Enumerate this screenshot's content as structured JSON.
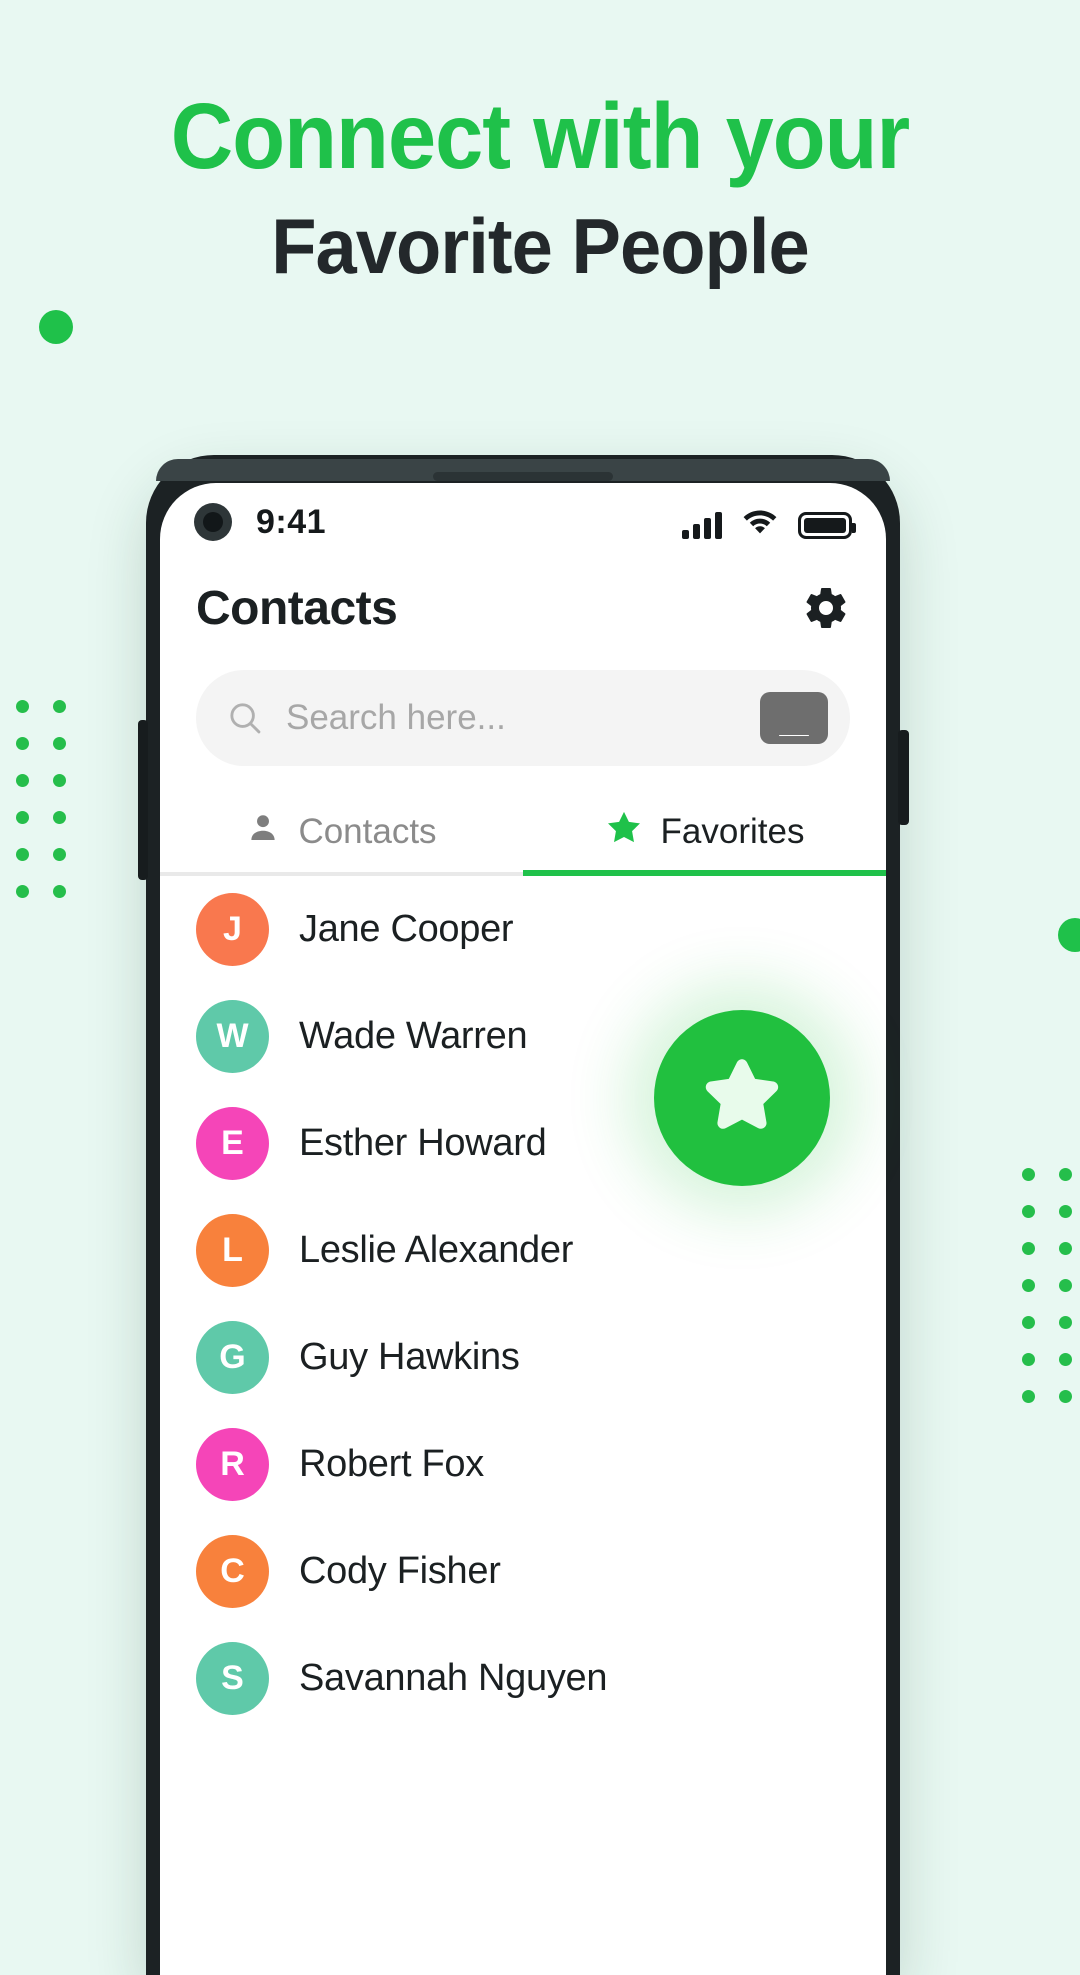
{
  "promo": {
    "headline_line1": "Connect with your",
    "headline_line2": "Favorite People",
    "accent_color": "#1FC14A",
    "dark_color": "#23282B",
    "background_color": "#E8F8F2"
  },
  "phone": {
    "statusbar": {
      "time": "9:41",
      "signal_icon": "signal-bars-icon",
      "wifi_icon": "wifi-icon",
      "battery_icon": "battery-full-icon",
      "camera_icon": "front-camera-icon"
    },
    "header": {
      "title": "Contacts",
      "settings_icon": "gear-icon"
    },
    "search": {
      "placeholder": "Search here...",
      "value": "",
      "search_icon": "search-icon",
      "keyboard_icon": "keyboard-icon"
    },
    "tabs": [
      {
        "label": "Contacts",
        "icon": "person-icon",
        "active": false
      },
      {
        "label": "Favorites",
        "icon": "star-icon",
        "active": true
      }
    ],
    "contacts": [
      {
        "initial": "J",
        "name": "Jane Cooper",
        "color": "#F9784E"
      },
      {
        "initial": "W",
        "name": "Wade Warren",
        "color": "#5FC9A9"
      },
      {
        "initial": "E",
        "name": "Esther Howard",
        "color": "#F545B8"
      },
      {
        "initial": "L",
        "name": "Leslie Alexander",
        "color": "#F8813C"
      },
      {
        "initial": "G",
        "name": "Guy Hawkins",
        "color": "#5FC9A9"
      },
      {
        "initial": "R",
        "name": "Robert Fox",
        "color": "#F545B8"
      },
      {
        "initial": "C",
        "name": "Cody Fisher",
        "color": "#F8813C"
      },
      {
        "initial": "S",
        "name": "Savannah Nguyen",
        "color": "#5FC9A9"
      }
    ],
    "fab": {
      "icon": "star-icon",
      "color": "#21C03F"
    }
  },
  "decor": {
    "dot_color": "#25BE4B",
    "left_grid_rows": 6,
    "right_grid_rows": 7
  }
}
